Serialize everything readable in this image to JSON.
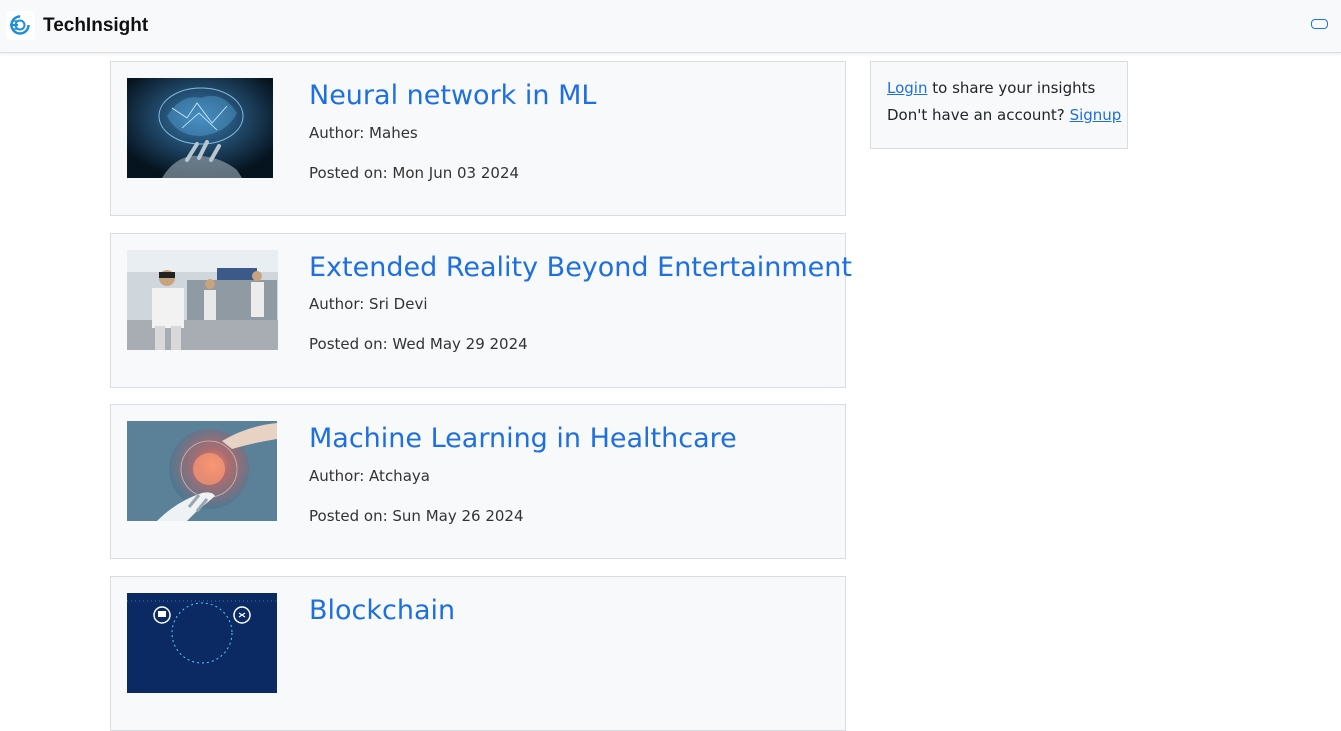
{
  "navbar": {
    "brand_name": "TechInsight",
    "brand_icon": "logo-icon",
    "toggler_icon": "menu-toggle-icon"
  },
  "posts": [
    {
      "title": "Neural network in ML",
      "author": "Author: Mahes",
      "date": "Posted on: Mon Jun 03 2024",
      "image": "glowing-brain-over-hand"
    },
    {
      "title": "Extended Reality Beyond Entertainment",
      "author": "Author: Sri Devi",
      "date": "Posted on: Wed May 29 2024",
      "image": "vr-headset-factory"
    },
    {
      "title": "Machine Learning in Healthcare",
      "author": "Author: Atchaya",
      "date": "Posted on: Sun May 26 2024",
      "image": "robot-hand-human-hand"
    },
    {
      "title": "Blockchain",
      "author": "",
      "date": "",
      "image": "blockchain-network-icons"
    }
  ],
  "sidebar": {
    "login_link": "Login",
    "login_suffix": "to share your insights",
    "no_account_text": "Don't have an account?",
    "signup_link": "Signup"
  },
  "colors": {
    "link": "#1e6fe0",
    "card_bg": "#f8f9fa",
    "navbar_bg": "#f8f9fa"
  }
}
